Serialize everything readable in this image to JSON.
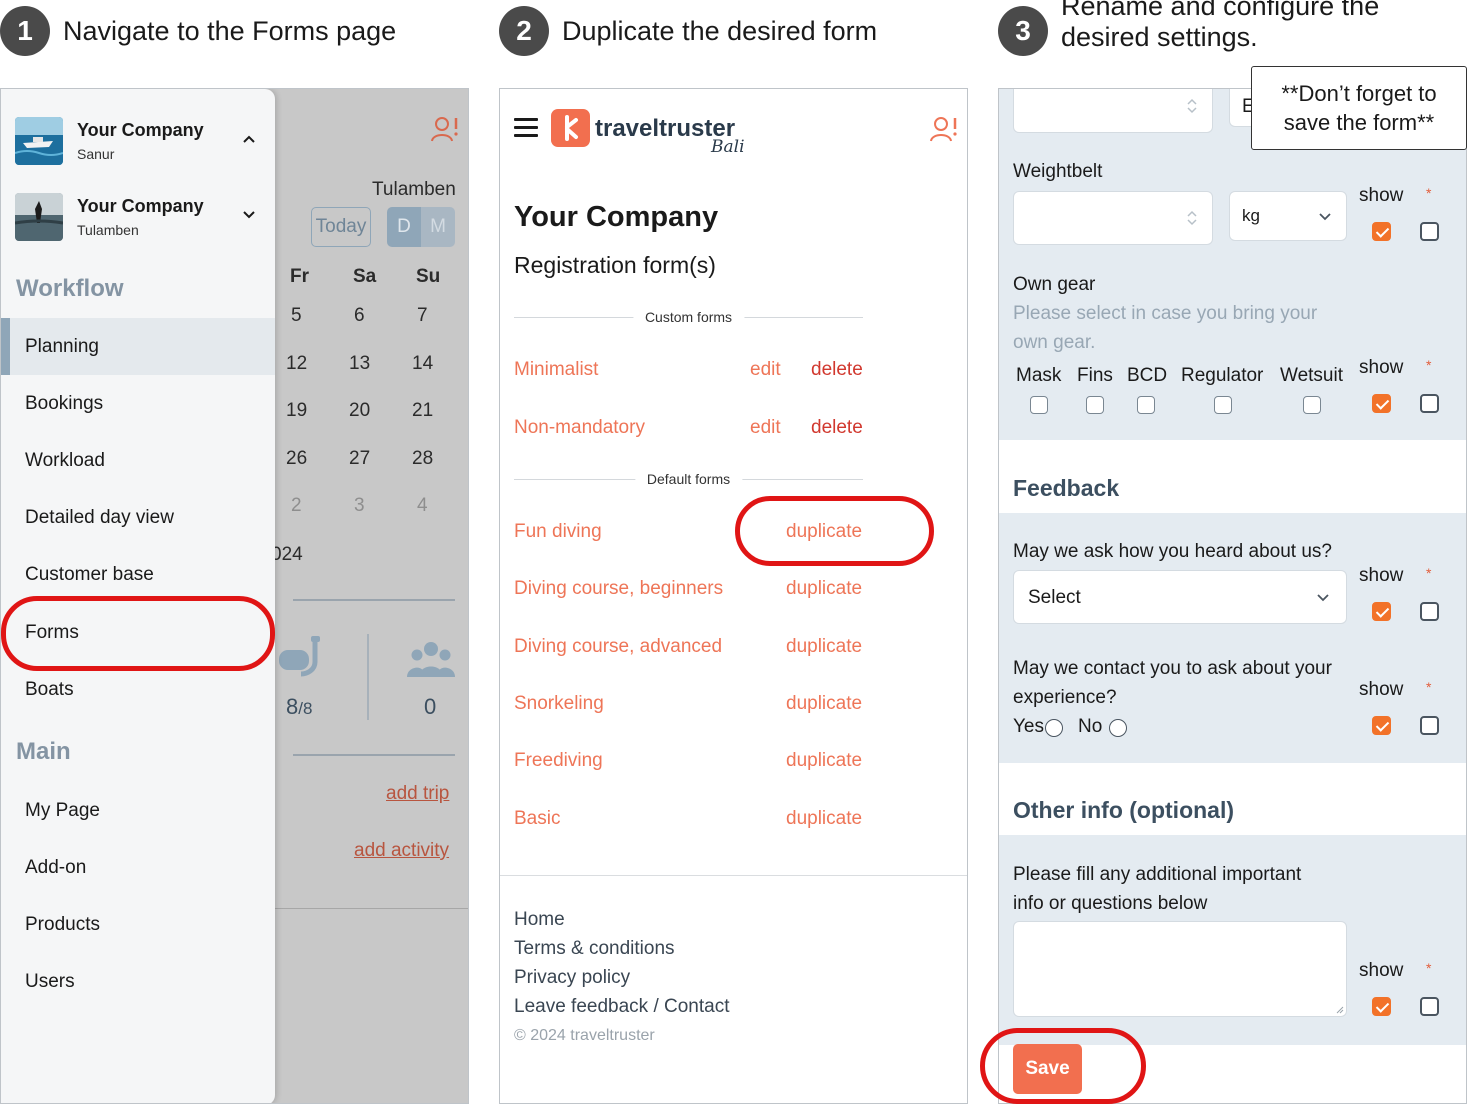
{
  "steps": [
    {
      "number": "1",
      "text": "Navigate to the Forms page"
    },
    {
      "number": "2",
      "text": "Duplicate the desired form"
    },
    {
      "number": "3",
      "text_line1": "Rename and configure the",
      "text_line2": "desired settings."
    }
  ],
  "note": {
    "line1": "**Don’t forget to",
    "line2": "save the form**"
  },
  "panel1": {
    "companies": [
      {
        "name": "Your Company",
        "location": "Sanur",
        "chevron": "chevron-up-icon"
      },
      {
        "name": "Your Company",
        "location": "Tulamben",
        "chevron": "chevron-down-icon"
      }
    ],
    "sections": {
      "workflow": "Workflow",
      "main": "Main"
    },
    "workflow_items": [
      "Planning",
      "Bookings",
      "Workload",
      "Detailed day view",
      "Customer base",
      "Forms",
      "Boats"
    ],
    "main_items": [
      "My Page",
      "Add-on",
      "Products",
      "Users"
    ],
    "active_item": "Planning",
    "background": {
      "location": "Tulamben",
      "today": "Today",
      "view_d": "D",
      "view_m": "M",
      "day_headers": [
        "Fr",
        "Sa",
        "Su"
      ],
      "weeks": [
        [
          "5",
          "6",
          "7"
        ],
        [
          "12",
          "13",
          "14"
        ],
        [
          "19",
          "20",
          "21"
        ],
        [
          "26",
          "27",
          "28"
        ],
        [
          "2",
          "3",
          "4"
        ]
      ],
      "year_fragment": "024",
      "divers_count": "8",
      "divers_total": "/8",
      "people_count": "0",
      "add_trip": "add trip",
      "add_activity": "add activity"
    }
  },
  "panel2": {
    "logo": {
      "word": "traveltruster",
      "sub": "Bali"
    },
    "company": "Your Company",
    "subtitle": "Registration form(s)",
    "custom_label": "Custom forms",
    "default_label": "Default forms",
    "custom_forms": [
      {
        "name": "Minimalist",
        "edit": "edit",
        "delete": "delete"
      },
      {
        "name": "Non-mandatory",
        "edit": "edit",
        "delete": "delete"
      }
    ],
    "default_forms": [
      {
        "name": "Fun diving",
        "action": "duplicate"
      },
      {
        "name": "Diving course, beginners",
        "action": "duplicate"
      },
      {
        "name": "Diving course, advanced",
        "action": "duplicate"
      },
      {
        "name": "Snorkeling",
        "action": "duplicate"
      },
      {
        "name": "Freediving",
        "action": "duplicate"
      },
      {
        "name": "Basic",
        "action": "duplicate"
      }
    ],
    "footer_links": [
      "Home",
      "Terms & conditions",
      "Privacy policy",
      "Leave feedback / Contact"
    ],
    "copyright": "© 2024 traveltruster"
  },
  "panel3": {
    "top_partial": "E",
    "weightbelt": {
      "label": "Weightbelt",
      "unit": "kg",
      "show": "show",
      "required": "*",
      "show_checked": true,
      "required_checked": false
    },
    "own_gear": {
      "label": "Own gear",
      "hint_line1": "Please select in case you bring your",
      "hint_line2": "own gear.",
      "items": [
        "Mask",
        "Fins",
        "BCD",
        "Regulator",
        "Wetsuit"
      ],
      "show": "show",
      "required": "*",
      "show_checked": true,
      "required_checked": false
    },
    "feedback": {
      "title": "Feedback",
      "q1": "May we ask how you heard about us?",
      "q1_select": "Select",
      "q2_line1": "May we contact you to ask about your",
      "q2_line2": "experience?",
      "yes": "Yes",
      "no": "No",
      "show": "show",
      "required": "*"
    },
    "other": {
      "title": "Other info (optional)",
      "q_line1": "Please fill any additional important",
      "q_line2": "info or questions below",
      "show": "show",
      "required": "*"
    },
    "save": "Save"
  },
  "colors": {
    "accent": "#f26f4f",
    "checkbox_on": "#f27229",
    "highlight": "#e01515",
    "section_title": "#8494a3"
  }
}
